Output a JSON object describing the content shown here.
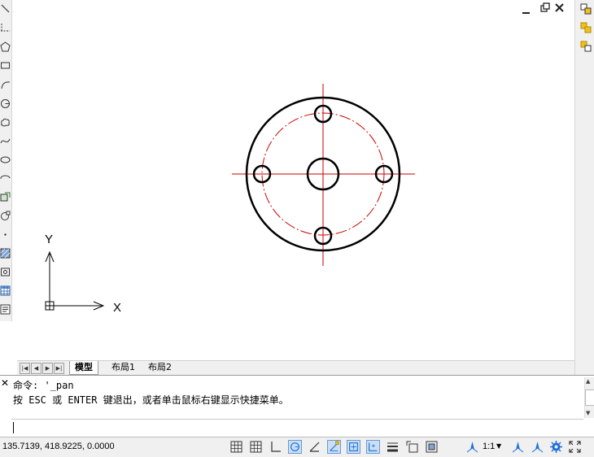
{
  "window_controls": {
    "minimize_icon": "minimize-icon",
    "restore_icon": "restore-icon",
    "close_icon": "close-icon"
  },
  "ucs": {
    "x_label": "X",
    "y_label": "Y"
  },
  "tabs": {
    "items": [
      {
        "label": "模型",
        "active": true
      },
      {
        "label": "布局1",
        "active": false
      },
      {
        "label": "布局2",
        "active": false
      }
    ]
  },
  "command": {
    "history": [
      "命令: '_pan",
      "按 ESC 或 ENTER 键退出，或者单击鼠标右键显示快捷菜单。"
    ],
    "input_value": ""
  },
  "status": {
    "coordinates": "135.7139, 418.9225, 0.0000",
    "scale": "1:1"
  },
  "colors": {
    "geometry": "#000000",
    "centerline": "#cc0000",
    "accent": "#1e6fd9"
  }
}
